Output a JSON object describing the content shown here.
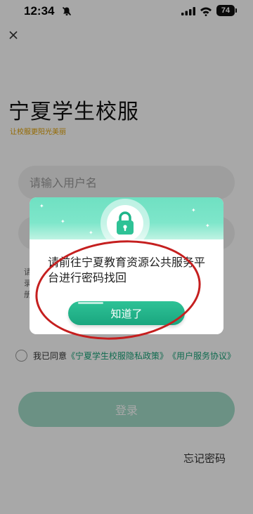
{
  "status_bar": {
    "time": "12:34",
    "battery": "74"
  },
  "header": {
    "title": "宁夏学生校服",
    "subtitle": "让校服更阳光美丽"
  },
  "form": {
    "username_placeholder": "请输入用户名",
    "hint": "请录册",
    "agree_prefix": "我已同意",
    "privacy_link": "《宁夏学生校服隐私政策》",
    "terms_link": "《用户服务协议》",
    "login_label": "登录",
    "forgot_label": "忘记密码"
  },
  "modal": {
    "message": "请前往宁夏教育资源公共服务平台进行密码找回",
    "ok_label": "知道了"
  },
  "colors": {
    "accent": "#1aa67f",
    "subtitle": "#e1a000",
    "annotation": "#c51f1f"
  },
  "icons": {
    "close": "close-icon",
    "lock": "lock-icon",
    "bell": "bell-muted-icon"
  }
}
